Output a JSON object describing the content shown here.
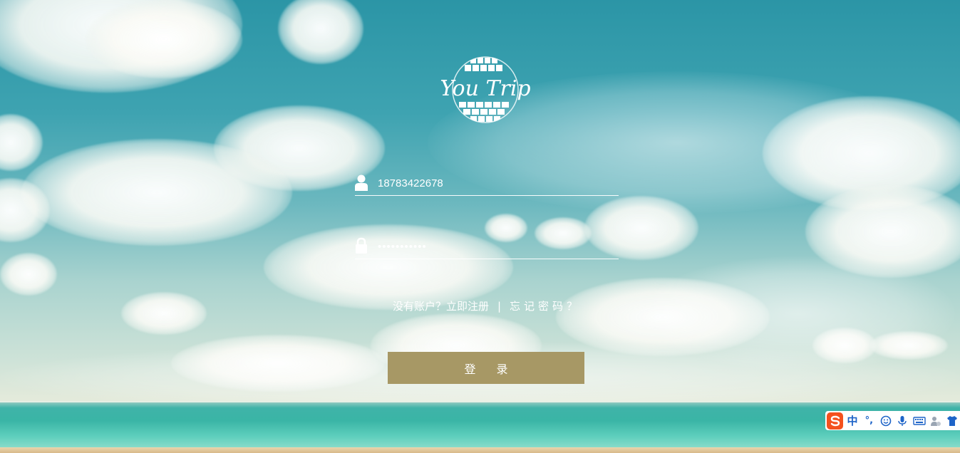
{
  "app": {
    "logo_text": "You Trip"
  },
  "form": {
    "username": {
      "value": "18783422678",
      "icon": "user-icon"
    },
    "password": {
      "value": "•••••••••••",
      "icon": "lock-icon"
    },
    "no_account_text": "没有账户？立即注册",
    "separator": "|",
    "forgot_text": "忘记密码？",
    "login_label": "登 录"
  },
  "ime_toolbar": {
    "mode_label": "中",
    "punct_label": "°,",
    "icons": [
      "sogou-s-icon",
      "emoji-icon",
      "mic-icon",
      "keyboard-icon",
      "user-settings-icon",
      "skin-shirt-icon"
    ]
  },
  "colors": {
    "login_button": "#a79865",
    "ime_accent": "#1e64c8",
    "ime_logo": "#f4511e"
  }
}
